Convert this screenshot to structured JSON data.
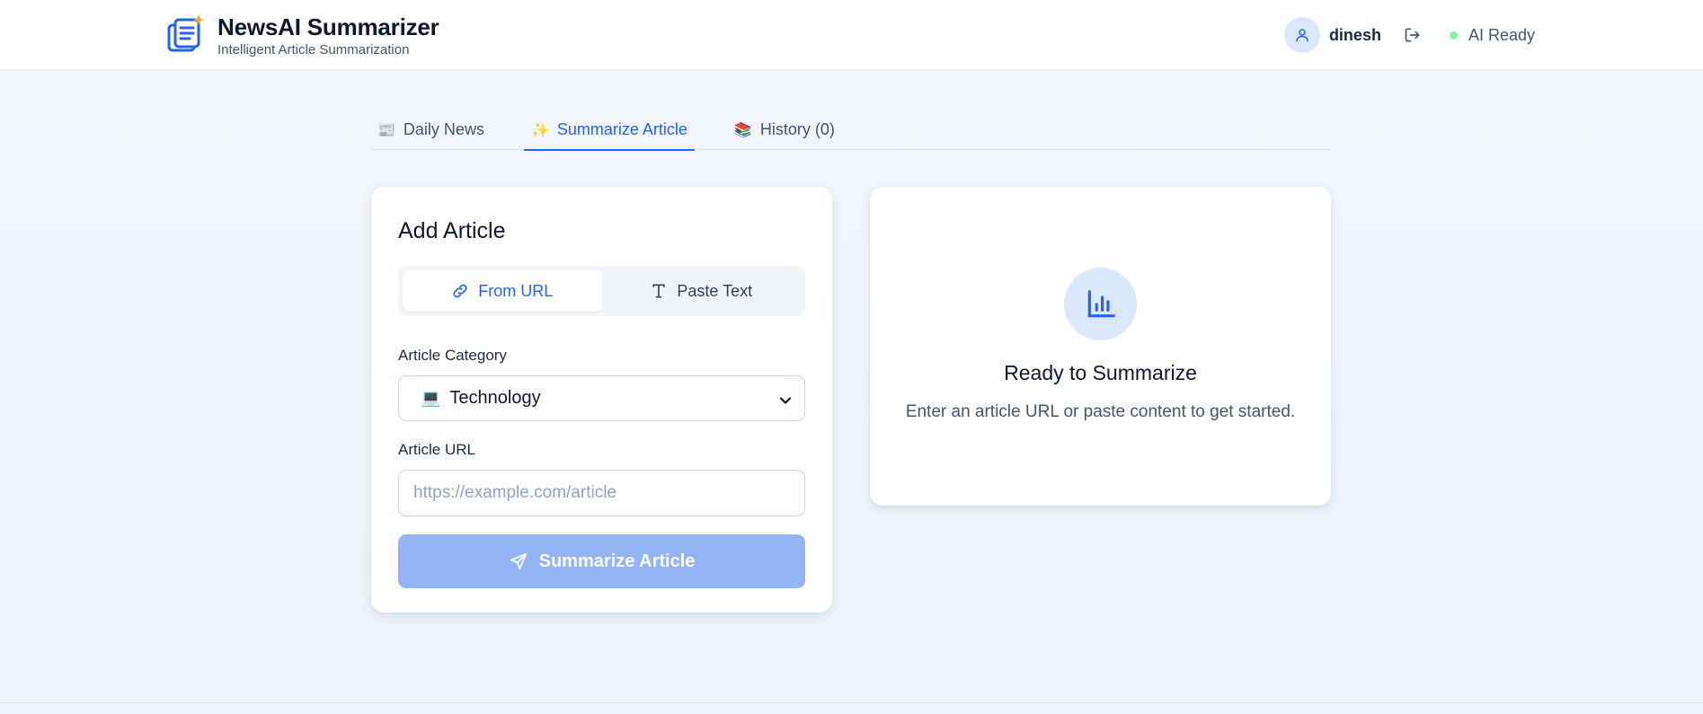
{
  "header": {
    "app_title": "NewsAI Summarizer",
    "app_subtitle": "Intelligent Article Summarization",
    "username": "dinesh",
    "status": "AI Ready",
    "logo_icon": "newspaper-sparkle-icon",
    "user_icon": "user-icon",
    "logout_icon": "logout-icon"
  },
  "tabs": [
    {
      "emoji": "📰",
      "label": "Daily News",
      "active": false
    },
    {
      "emoji": "✨",
      "label": "Summarize Article",
      "active": true
    },
    {
      "emoji": "📚",
      "label": "History (0)",
      "active": false
    }
  ],
  "add_article": {
    "title": "Add Article",
    "mode_url": "From URL",
    "mode_text": "Paste Text",
    "active_mode": "From URL",
    "category_label": "Article Category",
    "category_emoji": "💻",
    "category_value": "Technology",
    "url_label": "Article URL",
    "url_placeholder": "https://example.com/article",
    "url_value": "",
    "submit_label": "Summarize Article"
  },
  "ready_panel": {
    "icon": "bar-chart-icon",
    "title": "Ready to Summarize",
    "description": "Enter an article URL or paste content to get started."
  },
  "colors": {
    "accent": "#2563eb",
    "accent_light": "#dbe7fb",
    "submit_disabled": "#93b4f5",
    "status_dot": "#86efac"
  }
}
